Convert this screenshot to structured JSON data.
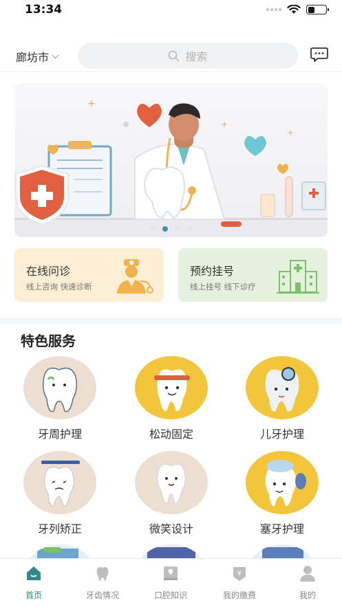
{
  "status": {
    "time": "13:34"
  },
  "header": {
    "city": "廊坊市",
    "search_placeholder": "搜索"
  },
  "banner": {
    "slides": 4,
    "active_slide": 2
  },
  "quick_cards": [
    {
      "title": "在线问诊",
      "subtitle": "线上咨询 快速诊断"
    },
    {
      "title": "预约挂号",
      "subtitle": "线上挂号 线下诊疗"
    }
  ],
  "section": {
    "title": "特色服务"
  },
  "services": [
    {
      "label": "牙周护理"
    },
    {
      "label": "松动固定"
    },
    {
      "label": "儿牙护理"
    },
    {
      "label": "牙列矫正"
    },
    {
      "label": "微笑设计"
    },
    {
      "label": "塞牙护理"
    }
  ],
  "tabs": [
    {
      "label": "首页",
      "icon": "home-icon"
    },
    {
      "label": "牙齿情况",
      "icon": "tooth-icon"
    },
    {
      "label": "口腔知识",
      "icon": "book-icon"
    },
    {
      "label": "我的缴费",
      "icon": "payment-icon"
    },
    {
      "label": "我的",
      "icon": "user-icon"
    }
  ],
  "colors": {
    "accent": "#2e8b89",
    "beige": "#ecdfd2",
    "yellow": "#f2c53d"
  }
}
